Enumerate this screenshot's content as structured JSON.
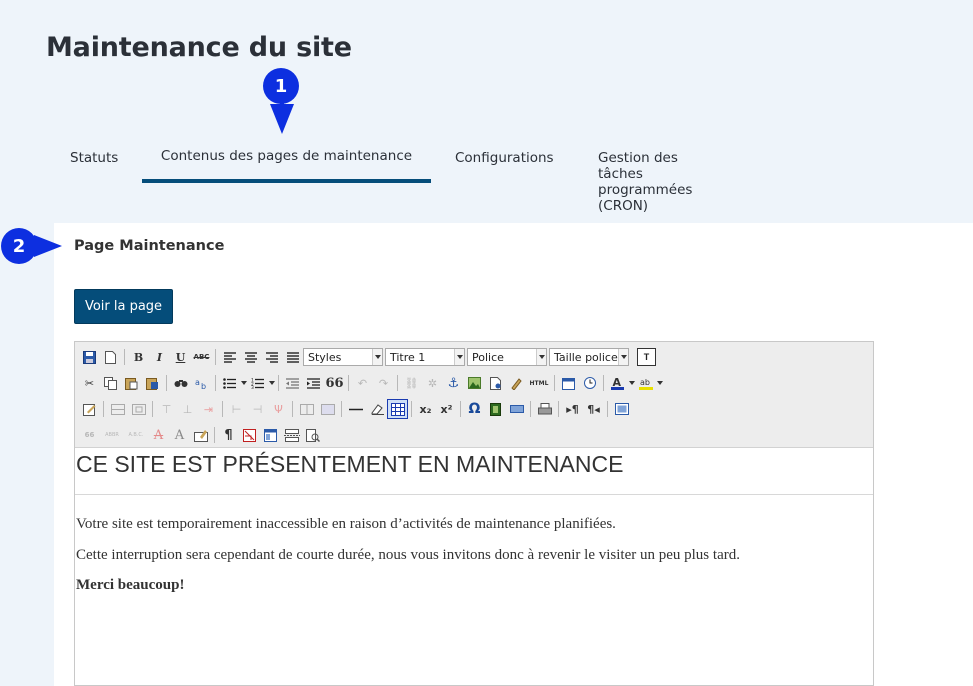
{
  "page": {
    "title": "Maintenance du site"
  },
  "markers": [
    "1",
    "2"
  ],
  "tabs": [
    {
      "label": "Statuts"
    },
    {
      "label": "Contenus des pages de maintenance",
      "active": true
    },
    {
      "label": "Configurations"
    },
    {
      "label": "Gestion des tâches programmées (CRON)"
    }
  ],
  "section": {
    "title": "Page Maintenance",
    "view_button": "Voir la page"
  },
  "editor": {
    "combos": {
      "styles": "Styles",
      "format": "Titre 1",
      "font": "Police",
      "size": "Taille police"
    },
    "toolbar_labels": {
      "bold": "B",
      "italic": "I",
      "underline": "U",
      "strike": "ABC",
      "textbox": "T",
      "html": "HTML",
      "subscript": "x₂",
      "superscript": "x²",
      "omega": "Ω",
      "pilcrow": "¶",
      "quote": "66",
      "abbr": "ABBR",
      "acronym": "A.B.C."
    },
    "colors": {
      "text_color": "#1a3bb0",
      "bg_color": "#e8e000",
      "accent": "#054d7a"
    },
    "content": {
      "heading": "CE SITE EST PRÉSENTEMENT EN MAINTENANCE",
      "paragraphs": [
        "Votre site est temporairement inaccessible en raison d’activités de maintenance planifiées.",
        "Cette interruption sera cependant de courte durée, nous vous invitons donc à revenir le visiter un peu plus tard."
      ],
      "closing": "Merci beaucoup!"
    }
  }
}
